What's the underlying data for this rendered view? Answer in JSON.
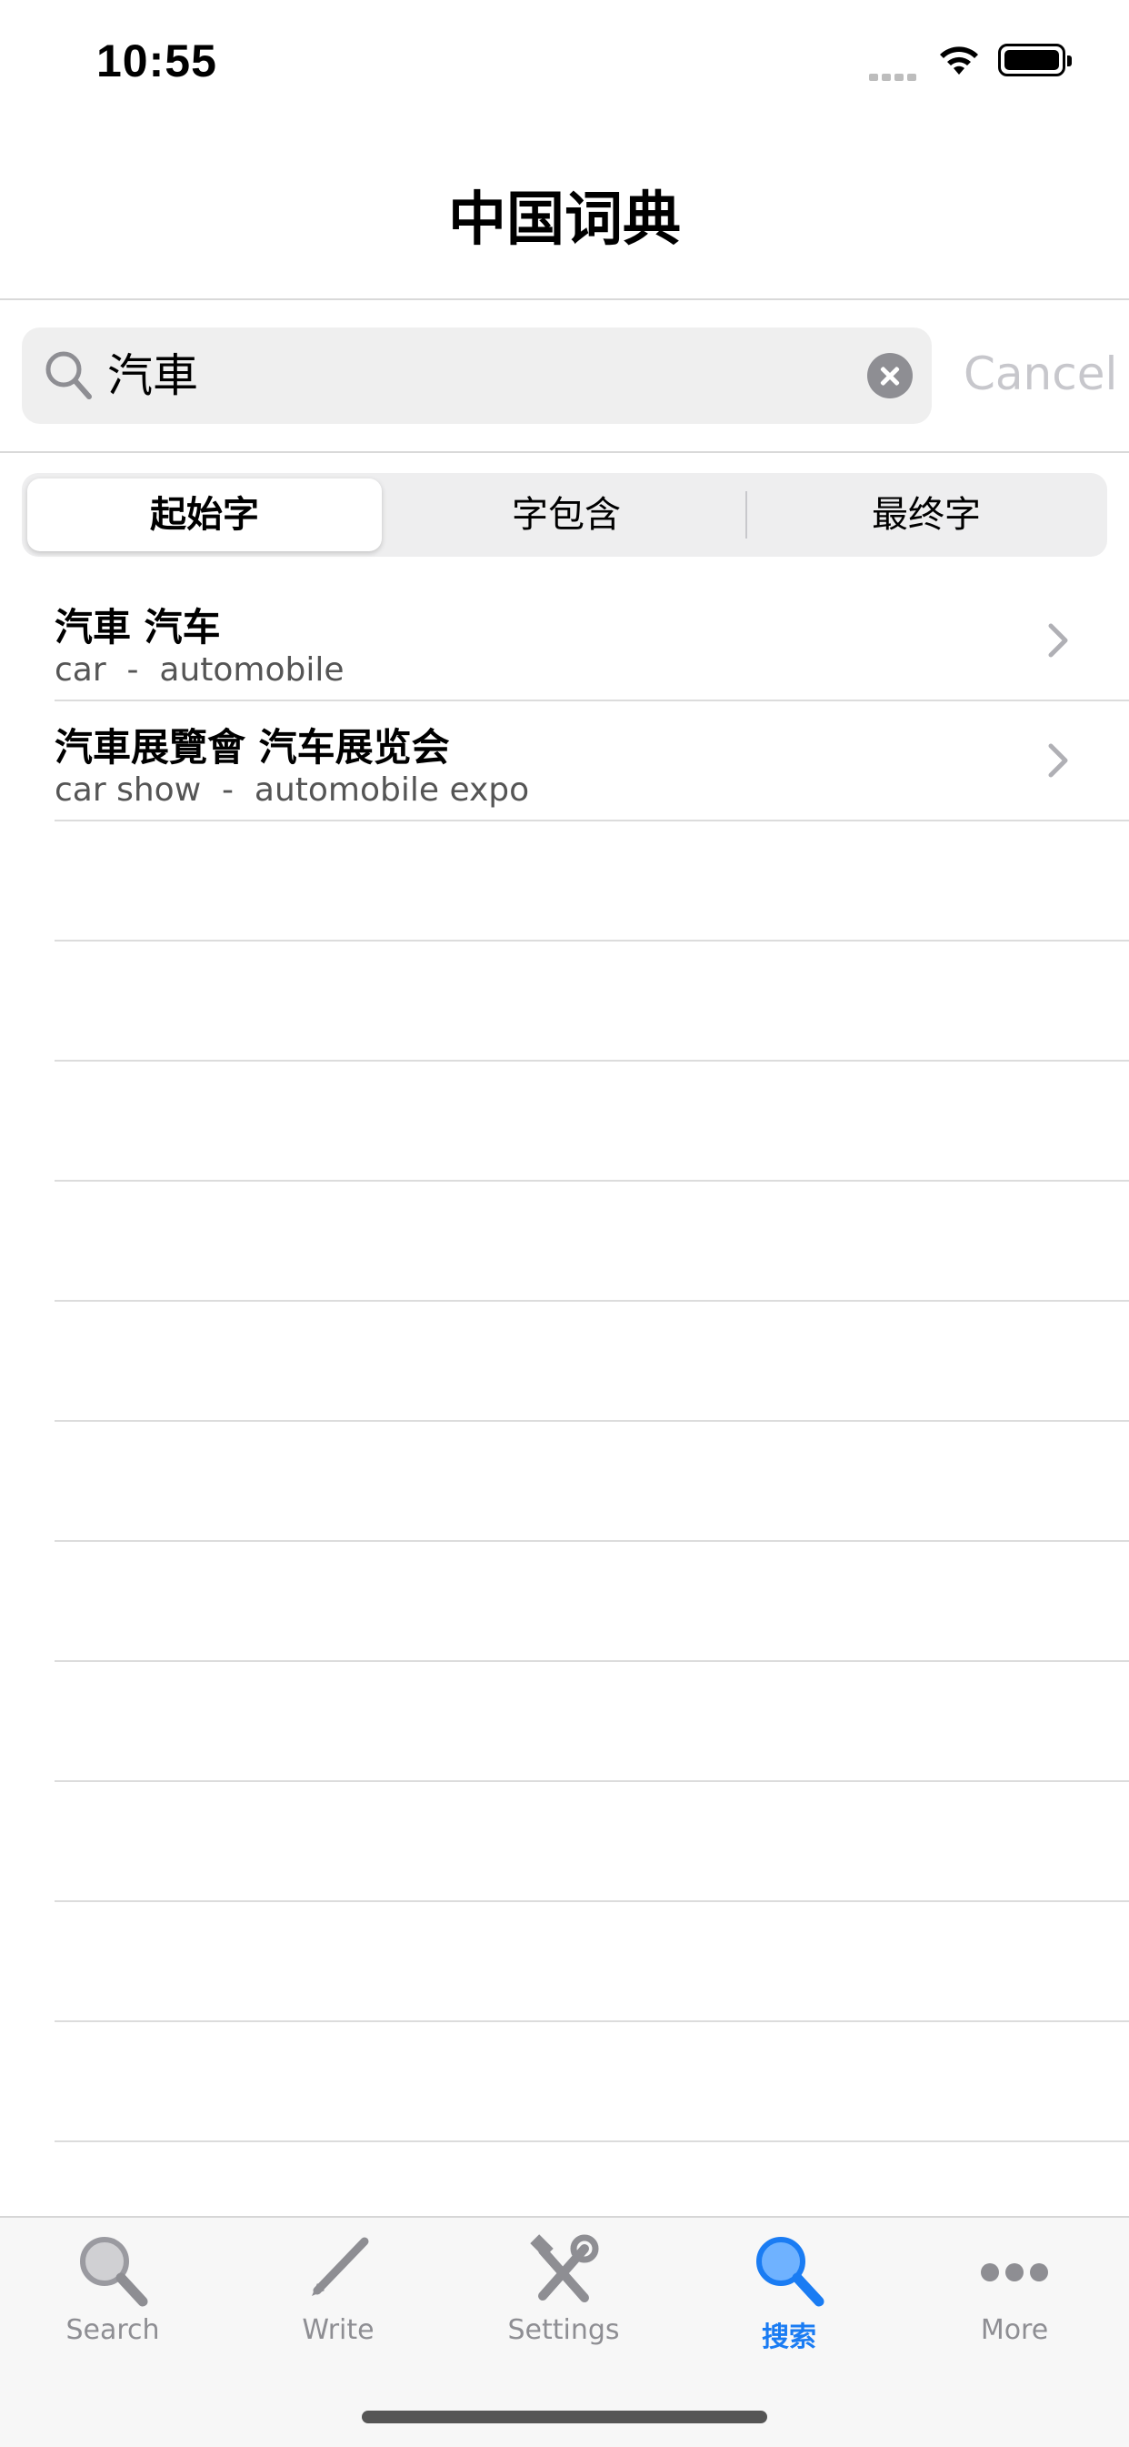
{
  "status_bar": {
    "time": "10:55"
  },
  "nav": {
    "title": "中国词典"
  },
  "search": {
    "value": "汽車",
    "cancel_label": "Cancel"
  },
  "segments": [
    {
      "label": "起始字",
      "selected": true
    },
    {
      "label": "字包含",
      "selected": false
    },
    {
      "label": "最终字",
      "selected": false
    }
  ],
  "results": [
    {
      "title": "汽車 汽车",
      "subtitle": "car  -  automobile"
    },
    {
      "title": "汽車展覽會 汽车展览会",
      "subtitle": "car show  -  automobile expo"
    }
  ],
  "tab_bar": {
    "tabs": [
      {
        "label": "Search",
        "icon": "magnifier-icon",
        "active": false
      },
      {
        "label": "Write",
        "icon": "pencil-icon",
        "active": false
      },
      {
        "label": "Settings",
        "icon": "tools-icon",
        "active": false
      },
      {
        "label": "搜索",
        "icon": "magnifier-icon",
        "active": true
      },
      {
        "label": "More",
        "icon": "ellipsis-icon",
        "active": false
      }
    ]
  },
  "colors": {
    "accent": "#1a7cf3",
    "inactive": "#8e8e93",
    "cancel": "#c7c7cc"
  }
}
